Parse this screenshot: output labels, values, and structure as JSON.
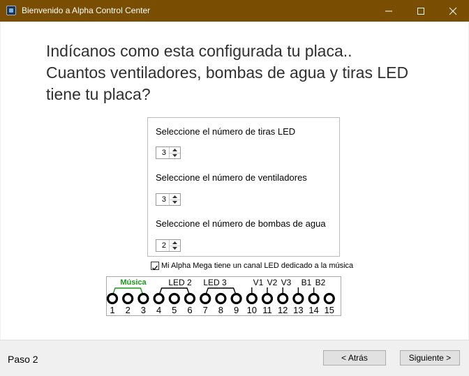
{
  "window": {
    "title": "Bienvenido a Alpha Control Center",
    "controls": {
      "minimize": "—",
      "maximize": "☐",
      "close": "✕"
    }
  },
  "heading": {
    "line1": "Indícanos como esta configurada tu placa..",
    "line2": "Cuantos ventiladores, bombas de agua y tiras LED",
    "line3": "tiene tu placa?"
  },
  "config": {
    "led_strips": {
      "label": "Seleccione el número de tiras LED",
      "value": "3"
    },
    "fans": {
      "label": "Seleccione el número de ventiladores",
      "value": "3"
    },
    "pumps": {
      "label": "Seleccione el número de bombas de agua",
      "value": "2"
    }
  },
  "music_channel": {
    "checked": true,
    "check_mark": "✓",
    "label": "Mi Alpha Mega tiene un canal LED dedicado a la música"
  },
  "diagram": {
    "group_labels": {
      "musica": "Música",
      "led2": "LED 2",
      "led3": "LED 3"
    },
    "pin_labels": {
      "v1": "V1",
      "v2": "V2",
      "v3": "V3",
      "b1": "B1",
      "b2": "B2"
    },
    "pin_numbers": [
      "1",
      "2",
      "3",
      "4",
      "5",
      "6",
      "7",
      "8",
      "9",
      "10",
      "11",
      "12",
      "13",
      "14",
      "15"
    ],
    "colors": {
      "musica": "#1a9a1a",
      "wire": "#000000"
    }
  },
  "footer": {
    "step": "Paso 2",
    "back_label": "< Atrás",
    "next_label": "Siguiente >"
  },
  "colors": {
    "titlebar": "#7a4e02",
    "background": "#f0f0f0",
    "client": "#ffffff"
  }
}
